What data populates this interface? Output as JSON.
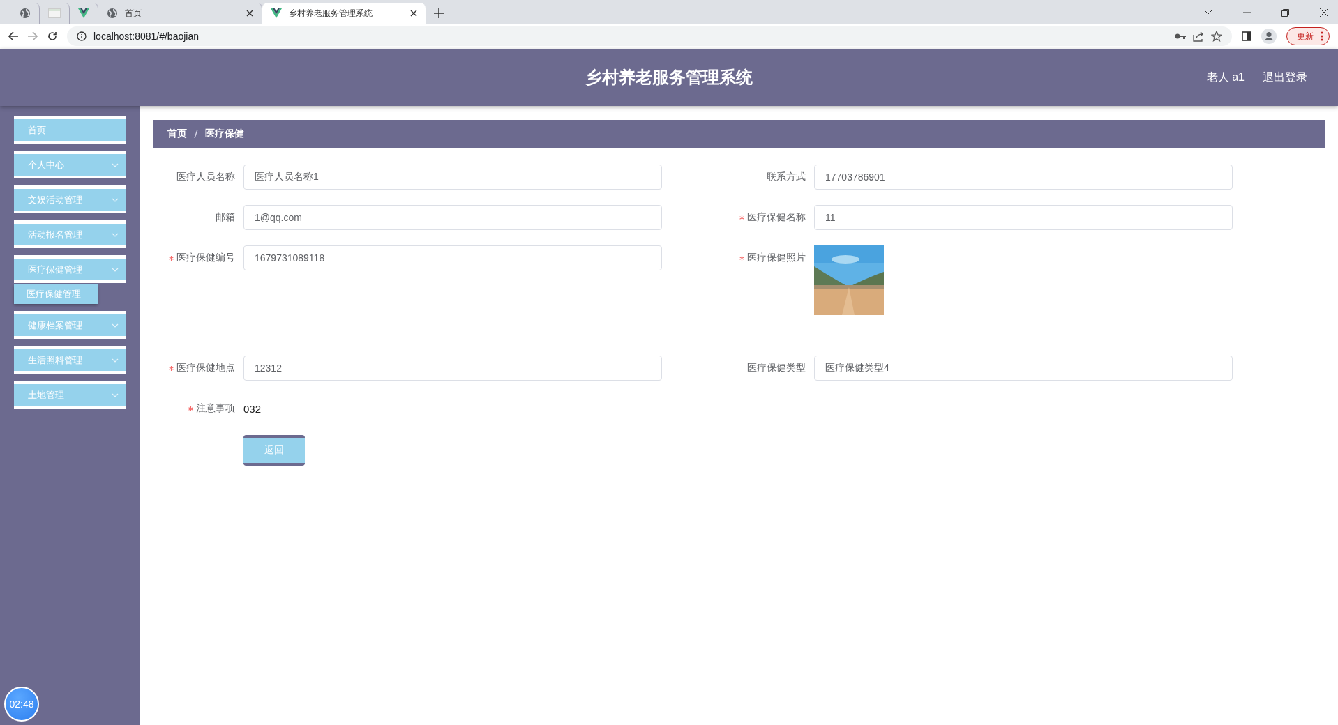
{
  "browser": {
    "tabs": [
      {
        "kind": "globe",
        "selected": false
      },
      {
        "kind": "page",
        "selected": false
      },
      {
        "kind": "vue",
        "selected": false
      },
      {
        "kind": "globe",
        "label": "首页",
        "selected": false
      },
      {
        "kind": "vue",
        "label": "乡村养老服务管理系统",
        "selected": true
      }
    ],
    "url": "localhost:8081/#/baojian",
    "update_button": "更新"
  },
  "header": {
    "title": "乡村养老服务管理系统",
    "user": "老人 a1",
    "logout": "退出登录"
  },
  "sidebar": {
    "items": [
      {
        "label": "首页",
        "kind": "link"
      },
      {
        "label": "个人中心",
        "kind": "submenu"
      },
      {
        "label": "文娱活动管理",
        "kind": "submenu"
      },
      {
        "label": "活动报名管理",
        "kind": "submenu"
      },
      {
        "label": "医疗保健管理",
        "kind": "submenu",
        "children": [
          {
            "label": "医疗保健管理"
          }
        ]
      },
      {
        "label": "健康档案管理",
        "kind": "submenu"
      },
      {
        "label": "生活照料管理",
        "kind": "submenu"
      },
      {
        "label": "土地管理",
        "kind": "submenu"
      }
    ]
  },
  "breadcrumb": [
    "首页",
    "医疗保健"
  ],
  "form": {
    "rows": [
      [
        {
          "label": "医疗人员名称",
          "kind": "input",
          "value": "医疗人员名称1",
          "required": false
        },
        {
          "label": "联系方式",
          "kind": "input",
          "value": "17703786901",
          "required": false
        }
      ],
      [
        {
          "label": "邮箱",
          "kind": "input",
          "value": "1@qq.com",
          "required": false
        },
        {
          "label": "医疗保健名称",
          "kind": "input",
          "value": "11",
          "required": true
        }
      ],
      [
        {
          "label": "医疗保健编号",
          "kind": "input",
          "value": "1679731089118",
          "required": true
        },
        {
          "label": "医疗保健照片",
          "required": true
        }
      ],
      [
        {
          "label": "医疗保健地点",
          "kind": "input",
          "value": "12312",
          "required": true
        },
        {
          "label": "医疗保健类型",
          "kind": "input",
          "value": "医疗保健类型4",
          "required": false
        }
      ],
      [
        {
          "label": "注意事项",
          "kind": "text",
          "value": "032",
          "required": true
        }
      ]
    ],
    "back_button": "返回"
  },
  "clock": "02:48"
}
